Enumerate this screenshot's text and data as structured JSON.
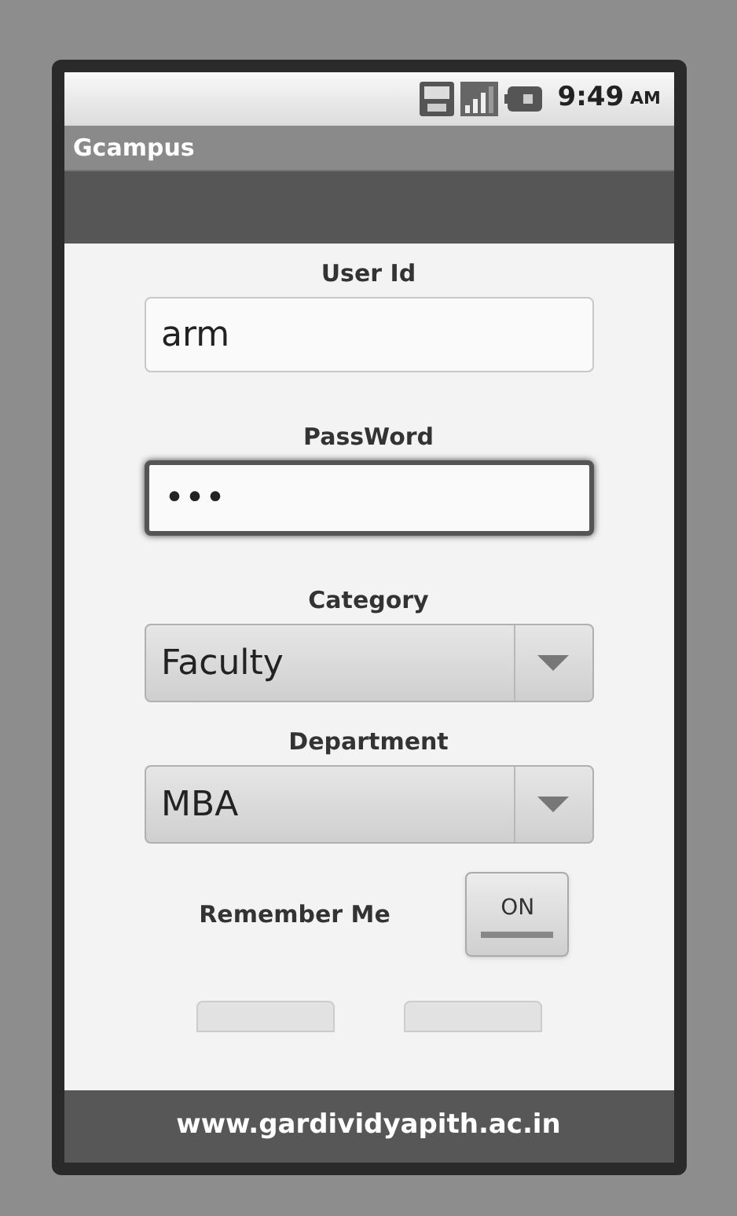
{
  "status_bar": {
    "time": "9:49",
    "ampm": "AM"
  },
  "app_bar": {
    "title": "Gcampus"
  },
  "form": {
    "fields": [
      {
        "kind": "text",
        "label": "User Id",
        "value": "arm",
        "focused": false
      },
      {
        "kind": "password",
        "label": "PassWord",
        "value": "•••",
        "focused": true
      },
      {
        "kind": "dropdown",
        "label": "Category",
        "value": "Faculty"
      },
      {
        "kind": "dropdown",
        "label": "Department",
        "value": "MBA"
      }
    ],
    "remember": {
      "label": "Remember Me",
      "toggle_text": "ON",
      "on": true
    }
  },
  "footer": {
    "text": "www.gardividyapith.ac.in"
  }
}
